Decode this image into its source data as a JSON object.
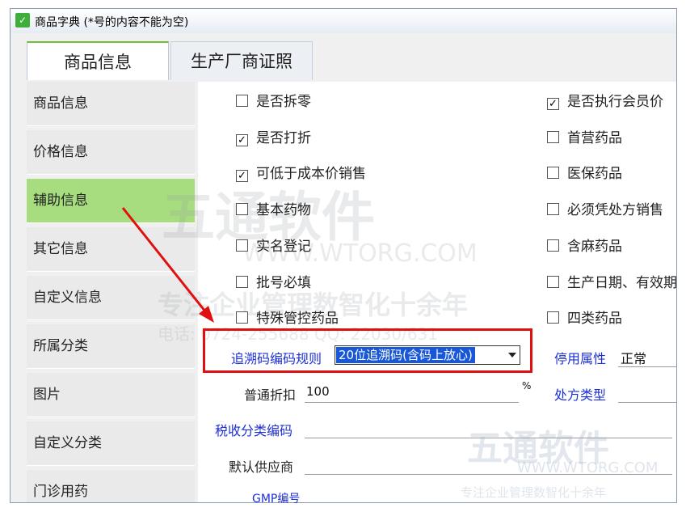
{
  "window": {
    "title": "商品字典 (*号的内容不能为空)"
  },
  "tabs": [
    {
      "label": "商品信息",
      "active": true
    },
    {
      "label": "生产厂商证照",
      "active": false
    }
  ],
  "sidebar": {
    "items": [
      {
        "label": "商品信息"
      },
      {
        "label": "价格信息"
      },
      {
        "label": "辅助信息",
        "active": true
      },
      {
        "label": "其它信息"
      },
      {
        "label": "自定义信息"
      },
      {
        "label": "所属分类"
      },
      {
        "label": "图片"
      },
      {
        "label": "自定义分类"
      },
      {
        "label": "门诊用药"
      }
    ]
  },
  "checkboxes_left": [
    {
      "label": "是否拆零",
      "checked": false
    },
    {
      "label": "是否打折",
      "checked": true
    },
    {
      "label": "可低于成本价销售",
      "checked": true
    },
    {
      "label": "基本药物",
      "checked": false
    },
    {
      "label": "实名登记",
      "checked": false
    },
    {
      "label": "批号必填",
      "checked": false
    },
    {
      "label": "特殊管控药品",
      "checked": false
    }
  ],
  "checkboxes_right": [
    {
      "label": "是否执行会员价",
      "checked": true
    },
    {
      "label": "首营药品",
      "checked": false
    },
    {
      "label": "医保药品",
      "checked": false
    },
    {
      "label": "必须凭处方销售",
      "checked": false
    },
    {
      "label": "含麻药品",
      "checked": false
    },
    {
      "label": "生产日期、有效期",
      "checked": false
    },
    {
      "label": "四类药品",
      "checked": false
    }
  ],
  "fields": {
    "trace_rule_label": "追溯码编码规则",
    "trace_rule_value": "20位追溯码(含码上放心)",
    "disable_attr_label": "停用属性",
    "disable_attr_value": "正常",
    "discount_label": "普通折扣",
    "discount_value": "100",
    "discount_unit": "%",
    "prescription_type_label": "处方类型",
    "tax_code_label": "税收分类编码",
    "default_supplier_label": "默认供应商",
    "gmp_label": "GMP编号"
  },
  "watermark": {
    "brand": "五通软件",
    "url": "WWW.WTORG.COM",
    "slogan": "专注企业管理数智化十余年",
    "contact": "电话: 0724-255688  QQ: 22030/631"
  },
  "colors": {
    "highlight_red": "#e01010",
    "active_green": "#a7dd7e",
    "label_blue": "#1c2fd6",
    "selection_blue": "#1858d6"
  }
}
